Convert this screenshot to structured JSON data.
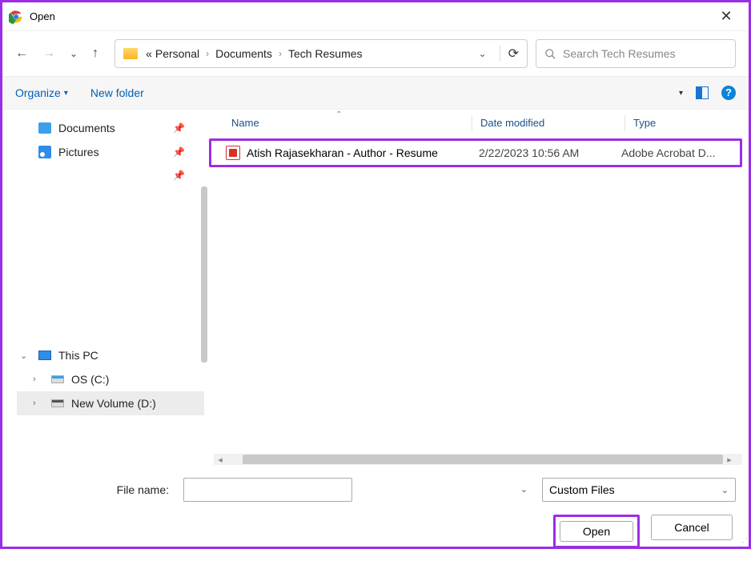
{
  "window": {
    "title": "Open"
  },
  "breadcrumb": {
    "prefix": "«",
    "parts": [
      "Personal",
      "Documents",
      "Tech Resumes"
    ]
  },
  "search": {
    "placeholder": "Search Tech Resumes"
  },
  "toolbar": {
    "organize": "Organize",
    "newfolder": "New folder"
  },
  "sidebar": {
    "quick": [
      {
        "label": "Documents",
        "kind": "doc",
        "pinned": true
      },
      {
        "label": "Pictures",
        "kind": "pic",
        "pinned": true
      }
    ],
    "thispc": {
      "label": "This PC",
      "drives": [
        {
          "label": "OS (C:)",
          "kind": "os"
        },
        {
          "label": "New Volume (D:)",
          "kind": "nv",
          "selected": true
        }
      ]
    }
  },
  "columns": {
    "name": "Name",
    "date": "Date modified",
    "type": "Type"
  },
  "files": [
    {
      "name": "Atish Rajasekharan - Author - Resume",
      "date": "2/22/2023 10:56 AM",
      "type": "Adobe Acrobat D..."
    }
  ],
  "footer": {
    "filename_label": "File name:",
    "filter": "Custom Files",
    "open": "Open",
    "cancel": "Cancel"
  }
}
